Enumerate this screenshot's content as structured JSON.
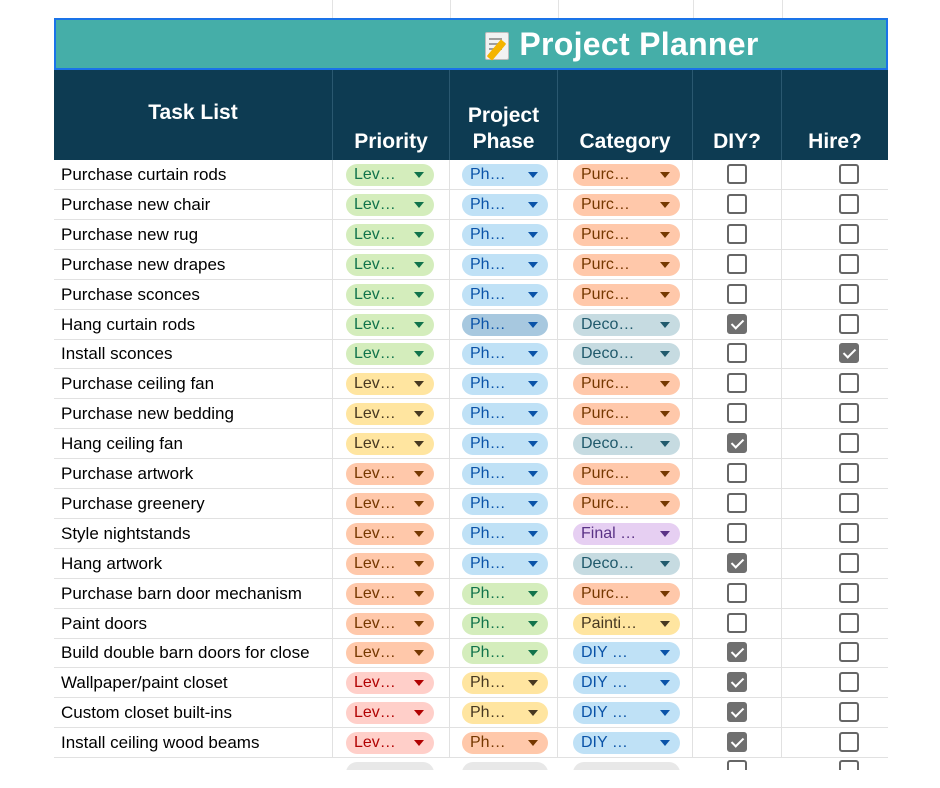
{
  "title": {
    "icon": "memo-icon",
    "text": "Project Planner"
  },
  "colors": {
    "title_bg": "#45aea8",
    "header_bg": "#0d3b52",
    "chip_green_bg": "#d4edbc",
    "chip_green_fg": "#11734b",
    "chip_yellow_bg": "#ffe5a0",
    "chip_yellow_fg": "#473821",
    "chip_orange_bg": "#ffcfc9",
    "chip_orange_fg": "#b10202",
    "chip_salmon_bg": "#ffc8aa",
    "chip_salmon_fg": "#753800",
    "chip_red_bg": "#ffcfc9",
    "chip_red_fg": "#b10202",
    "chip_blue_bg": "#bfe1f6",
    "chip_blue_fg": "#0a53a8",
    "chip_grayblue_bg": "#c6dbe1",
    "chip_grayblue_fg": "#215a6c",
    "chip_purple_bg": "#e6cff2",
    "chip_purple_fg": "#5a3286"
  },
  "columns": {
    "task": "Task List",
    "priority": "Priority",
    "phase_line1": "Project",
    "phase_line2": "Phase",
    "category": "Category",
    "diy": "DIY?",
    "hire": "Hire?"
  },
  "rows": [
    {
      "task": "Purchase curtain rods",
      "priority": "Lev…",
      "pcolor": "green",
      "phase": "Ph…",
      "phcolor": "blue",
      "category": "Purc…",
      "ccolor": "salmon",
      "diy": false,
      "hire": false
    },
    {
      "task": "Purchase new chair",
      "priority": "Lev…",
      "pcolor": "green",
      "phase": "Ph…",
      "phcolor": "blue",
      "category": "Purc…",
      "ccolor": "salmon",
      "diy": false,
      "hire": false
    },
    {
      "task": "Purchase new rug",
      "priority": "Lev…",
      "pcolor": "green",
      "phase": "Ph…",
      "phcolor": "blue",
      "category": "Purc…",
      "ccolor": "salmon",
      "diy": false,
      "hire": false
    },
    {
      "task": "Purchase new drapes",
      "priority": "Lev…",
      "pcolor": "green",
      "phase": "Ph…",
      "phcolor": "blue",
      "category": "Purc…",
      "ccolor": "salmon",
      "diy": false,
      "hire": false
    },
    {
      "task": "Purchase sconces",
      "priority": "Lev…",
      "pcolor": "green",
      "phase": "Ph…",
      "phcolor": "blue",
      "category": "Purc…",
      "ccolor": "salmon",
      "diy": false,
      "hire": false
    },
    {
      "task": "Hang curtain rods",
      "priority": "Lev…",
      "pcolor": "green",
      "phase": "Ph…",
      "phcolor": "bluedark",
      "category": "Deco…",
      "ccolor": "grayblue",
      "diy": true,
      "hire": false
    },
    {
      "task": "Install sconces",
      "priority": "Lev…",
      "pcolor": "green",
      "phase": "Ph…",
      "phcolor": "blue",
      "category": "Deco…",
      "ccolor": "grayblue",
      "diy": false,
      "hire": true
    },
    {
      "task": "Purchase ceiling fan",
      "priority": "Lev…",
      "pcolor": "yellow",
      "phase": "Ph…",
      "phcolor": "blue",
      "category": "Purc…",
      "ccolor": "salmon",
      "diy": false,
      "hire": false
    },
    {
      "task": "Purchase new bedding",
      "priority": "Lev…",
      "pcolor": "yellow",
      "phase": "Ph…",
      "phcolor": "blue",
      "category": "Purc…",
      "ccolor": "salmon",
      "diy": false,
      "hire": false
    },
    {
      "task": "Hang ceiling fan",
      "priority": "Lev…",
      "pcolor": "yellow",
      "phase": "Ph…",
      "phcolor": "blue",
      "category": "Deco…",
      "ccolor": "grayblue",
      "diy": true,
      "hire": false
    },
    {
      "task": "Purchase artwork",
      "priority": "Lev…",
      "pcolor": "salmon",
      "phase": "Ph…",
      "phcolor": "blue",
      "category": "Purc…",
      "ccolor": "salmon",
      "diy": false,
      "hire": false
    },
    {
      "task": "Purchase greenery",
      "priority": "Lev…",
      "pcolor": "salmon",
      "phase": "Ph…",
      "phcolor": "blue",
      "category": "Purc…",
      "ccolor": "salmon",
      "diy": false,
      "hire": false
    },
    {
      "task": "Style nightstands",
      "priority": "Lev…",
      "pcolor": "salmon",
      "phase": "Ph…",
      "phcolor": "blue",
      "category": "Final …",
      "ccolor": "purple",
      "diy": false,
      "hire": false
    },
    {
      "task": "Hang artwork",
      "priority": "Lev…",
      "pcolor": "salmon",
      "phase": "Ph…",
      "phcolor": "blue",
      "category": "Deco…",
      "ccolor": "grayblue",
      "diy": true,
      "hire": false
    },
    {
      "task": "Purchase barn door mechanism",
      "priority": "Lev…",
      "pcolor": "salmon",
      "phase": "Ph…",
      "phcolor": "green",
      "category": "Purc…",
      "ccolor": "salmon",
      "diy": false,
      "hire": false
    },
    {
      "task": "Paint doors",
      "priority": "Lev…",
      "pcolor": "salmon",
      "phase": "Ph…",
      "phcolor": "green",
      "category": "Painti…",
      "ccolor": "yellow",
      "diy": false,
      "hire": false
    },
    {
      "task": "Build double barn doors for close",
      "priority": "Lev…",
      "pcolor": "salmon",
      "phase": "Ph…",
      "phcolor": "green",
      "category": "DIY …",
      "ccolor": "blue",
      "diy": true,
      "hire": false
    },
    {
      "task": "Wallpaper/paint closet",
      "priority": "Lev…",
      "pcolor": "red",
      "phase": "Ph…",
      "phcolor": "yellow",
      "category": "DIY …",
      "ccolor": "blue",
      "diy": true,
      "hire": false
    },
    {
      "task": "Custom closet built-ins",
      "priority": "Lev…",
      "pcolor": "red",
      "phase": "Ph…",
      "phcolor": "yellow",
      "category": "DIY …",
      "ccolor": "blue",
      "diy": true,
      "hire": false
    },
    {
      "task": "Install ceiling wood beams",
      "priority": "Lev…",
      "pcolor": "red",
      "phase": "Ph…",
      "phcolor": "salmon",
      "category": "DIY …",
      "ccolor": "blue",
      "diy": true,
      "hire": false
    }
  ]
}
